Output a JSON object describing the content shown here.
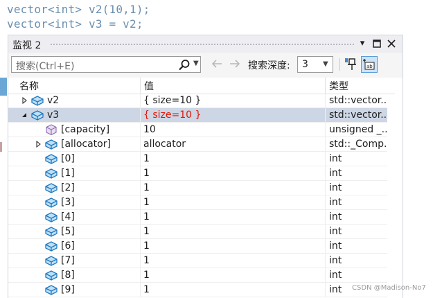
{
  "code": {
    "line1": "vector<int> v2(10,1);",
    "line2": "vector<int> v3 = v2;"
  },
  "window": {
    "title": "监视 2",
    "dropdown_glyph": "▾",
    "maximize_glyph": "□",
    "close_glyph": "✕"
  },
  "toolbar": {
    "search_placeholder": "搜索(Ctrl+E)",
    "depth_label": "搜索深度:",
    "depth_value": "3"
  },
  "columns": {
    "name": "名称",
    "value": "值",
    "type": "类型"
  },
  "rows": [
    {
      "name": "v2",
      "value": "{ size=10 }",
      "type": "std::vector...",
      "expander": "collapsed",
      "indent": 0,
      "icon": "object-icon"
    },
    {
      "name": "v3",
      "value": "{ size=10 }",
      "type": "std::vector...",
      "expander": "expanded",
      "indent": 0,
      "icon": "object-icon",
      "selected": true,
      "changed": true
    },
    {
      "name": "[capacity]",
      "value": "10",
      "type": "unsigned _...",
      "expander": "none",
      "indent": 1,
      "icon": "raw-view-icon"
    },
    {
      "name": "[allocator]",
      "value": "allocator",
      "type": "std::_Comp...",
      "expander": "collapsed",
      "indent": 1,
      "icon": "object-icon"
    },
    {
      "name": "[0]",
      "value": "1",
      "type": "int",
      "expander": "none",
      "indent": 1,
      "icon": "object-icon"
    },
    {
      "name": "[1]",
      "value": "1",
      "type": "int",
      "expander": "none",
      "indent": 1,
      "icon": "object-icon"
    },
    {
      "name": "[2]",
      "value": "1",
      "type": "int",
      "expander": "none",
      "indent": 1,
      "icon": "object-icon"
    },
    {
      "name": "[3]",
      "value": "1",
      "type": "int",
      "expander": "none",
      "indent": 1,
      "icon": "object-icon"
    },
    {
      "name": "[4]",
      "value": "1",
      "type": "int",
      "expander": "none",
      "indent": 1,
      "icon": "object-icon"
    },
    {
      "name": "[5]",
      "value": "1",
      "type": "int",
      "expander": "none",
      "indent": 1,
      "icon": "object-icon"
    },
    {
      "name": "[6]",
      "value": "1",
      "type": "int",
      "expander": "none",
      "indent": 1,
      "icon": "object-icon"
    },
    {
      "name": "[7]",
      "value": "1",
      "type": "int",
      "expander": "none",
      "indent": 1,
      "icon": "object-icon"
    },
    {
      "name": "[8]",
      "value": "1",
      "type": "int",
      "expander": "none",
      "indent": 1,
      "icon": "object-icon"
    },
    {
      "name": "[9]",
      "value": "1",
      "type": "int",
      "expander": "none",
      "indent": 1,
      "icon": "object-icon"
    }
  ],
  "colors": {
    "changed_value": "#e51400",
    "selected_row": "#cdd6e4",
    "code_text": "#6a8fb0"
  },
  "watermark": "CSDN @Madison-No7"
}
